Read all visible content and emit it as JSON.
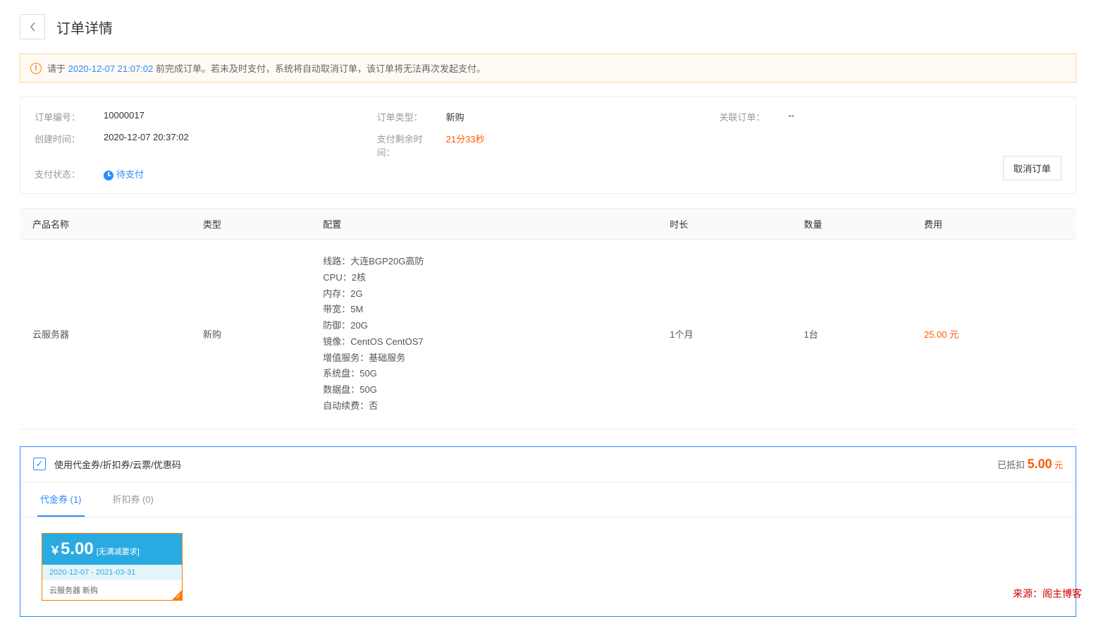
{
  "page": {
    "title": "订单详情"
  },
  "alert": {
    "prefix": "请于 ",
    "deadline": "2020-12-07 21:07:02",
    "suffix": " 前完成订单。若未及时支付，系统将自动取消订单，该订单将无法再次发起支付。"
  },
  "order": {
    "labels": {
      "id": "订单编号：",
      "type": "订单类型：",
      "related": "关联订单：",
      "created": "创建时间：",
      "remaining": "支付剩余时间：",
      "status": "支付状态："
    },
    "id": "10000017",
    "type": "新购",
    "related": "--",
    "created": "2020-12-07 20:37:02",
    "remaining": "21分33秒",
    "status": "待支付",
    "cancel_label": "取消订单"
  },
  "table": {
    "headers": {
      "product": "产品名称",
      "type": "类型",
      "config": "配置",
      "duration": "时长",
      "qty": "数量",
      "cost": "费用"
    },
    "row": {
      "product": "云服务器",
      "type": "新购",
      "config": [
        "线路：大连BGP20G高防",
        "CPU：2核",
        "内存：2G",
        "带宽：5M",
        "防御：20G",
        "镜像：CentOS CentOS7",
        "增值服务：基础服务",
        "系统盘：50G",
        "数据盘：50G",
        "自动续费：否"
      ],
      "duration": "1个月",
      "qty": "1台",
      "cost": "25.00 元"
    }
  },
  "coupon": {
    "checkbox_label": "使用代金券/折扣券/云票/优惠码",
    "deduct_prefix": "已抵扣 ",
    "deduct_amount": "5.00",
    "deduct_unit": " 元",
    "tabs": {
      "voucher": "代金券 (1)",
      "discount": "折扣券 (0)"
    },
    "voucher": {
      "currency": "￥",
      "amount": "5.00",
      "note": "[无满减要求]",
      "date": "2020-12-07 - 2021-03-31",
      "scope": "云服务器 新购"
    }
  },
  "source": "来源：阁主博客"
}
